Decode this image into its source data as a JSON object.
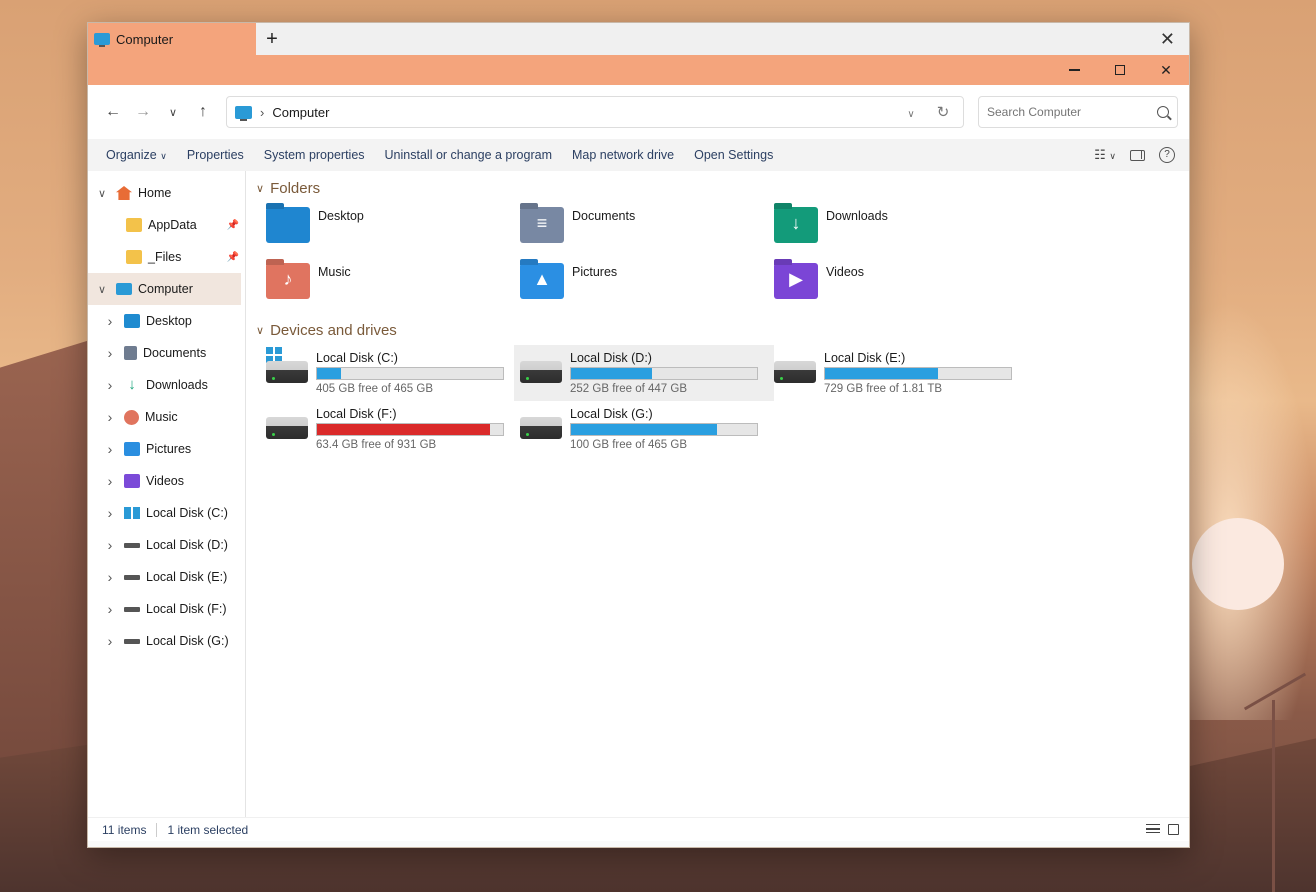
{
  "window": {
    "tab_title": "Computer",
    "new_tab": "+",
    "close_tab": "✕"
  },
  "address": {
    "path": "Computer",
    "separator": "›",
    "search_placeholder": "Search Computer"
  },
  "commands": {
    "organize": "Organize",
    "properties": "Properties",
    "system_properties": "System properties",
    "uninstall": "Uninstall or change a program",
    "map_drive": "Map network drive",
    "open_settings": "Open Settings"
  },
  "sidebar": {
    "home": "Home",
    "pinned": [
      {
        "label": "AppData"
      },
      {
        "label": "_Files"
      }
    ],
    "computer": "Computer",
    "computer_children": [
      {
        "label": "Desktop",
        "icon": "desktop-icon"
      },
      {
        "label": "Documents",
        "icon": "documents-icon"
      },
      {
        "label": "Downloads",
        "icon": "downloads-icon"
      },
      {
        "label": "Music",
        "icon": "music-icon"
      },
      {
        "label": "Pictures",
        "icon": "pictures-icon"
      },
      {
        "label": "Videos",
        "icon": "videos-icon"
      },
      {
        "label": "Local Disk (C:)",
        "icon": "windows-drive-icon"
      },
      {
        "label": "Local Disk (D:)",
        "icon": "drive-icon"
      },
      {
        "label": "Local Disk (E:)",
        "icon": "drive-icon"
      },
      {
        "label": "Local Disk (F:)",
        "icon": "drive-icon"
      },
      {
        "label": "Local Disk (G:)",
        "icon": "drive-icon"
      }
    ]
  },
  "content": {
    "folders_header": "Folders",
    "drives_header": "Devices and drives",
    "folders": [
      {
        "name": "Desktop",
        "color": "#1f86d0",
        "glyph": ""
      },
      {
        "name": "Documents",
        "color": "#7888a3",
        "glyph": "≡"
      },
      {
        "name": "Downloads",
        "color": "#139b7a",
        "glyph": "↓"
      },
      {
        "name": "Music",
        "color": "#e07460",
        "glyph": "♪"
      },
      {
        "name": "Pictures",
        "color": "#2b8fe3",
        "glyph": "▲"
      },
      {
        "name": "Videos",
        "color": "#7b45d6",
        "glyph": "▶"
      }
    ],
    "drives": [
      {
        "name": "Local Disk (C:)",
        "free_text": "405 GB free of 465 GB",
        "used_fraction": 0.129,
        "bar_color": "#2a9fe0",
        "windows": true
      },
      {
        "name": "Local Disk (D:)",
        "free_text": "252 GB free of 447 GB",
        "used_fraction": 0.436,
        "bar_color": "#2a9fe0",
        "windows": false
      },
      {
        "name": "Local Disk (E:)",
        "free_text": "729 GB free of 1.81 TB",
        "used_fraction": 0.607,
        "bar_color": "#2a9fe0",
        "windows": false
      },
      {
        "name": "Local Disk (F:)",
        "free_text": "63.4 GB free of 931 GB",
        "used_fraction": 0.932,
        "bar_color": "#da2a2a",
        "windows": false
      },
      {
        "name": "Local Disk (G:)",
        "free_text": "100 GB free of 465 GB",
        "used_fraction": 0.785,
        "bar_color": "#2a9fe0",
        "windows": false
      }
    ]
  },
  "status": {
    "items": "11 items",
    "selected": "1 item selected"
  }
}
